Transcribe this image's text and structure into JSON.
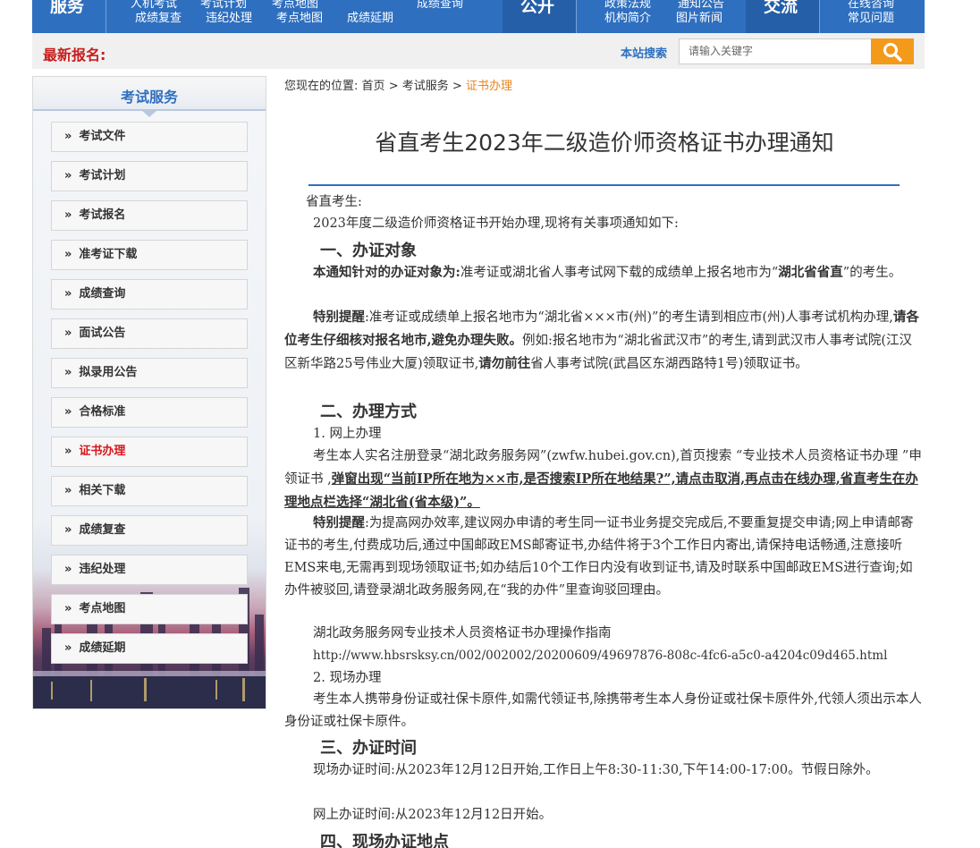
{
  "topnav": {
    "sec1_title": "服务",
    "sec1_cut": [
      "人机考试",
      "考试计划",
      "考点地图",
      "成绩查询"
    ],
    "sec1_links": [
      "成绩复查",
      "违纪处理",
      "考点地图",
      "成绩延期"
    ],
    "sec2_title": "公开",
    "sec2_cut": [
      "政策法规",
      "通知公告"
    ],
    "sec2_links": [
      "机构简介",
      "图片新闻"
    ],
    "sec3_title": "交流",
    "sec3_cut": "在线咨询",
    "sec3_link": "常见问题"
  },
  "bar2": {
    "latest_label": "最新报名:",
    "search_label": "本站搜索",
    "search_placeholder": "请输入关键字"
  },
  "sidebar": {
    "title": "考试服务",
    "items": [
      "考试文件",
      "考试计划",
      "考试报名",
      "准考证下载",
      "成绩查询",
      "面试公告",
      "拟录用公告",
      "合格标准",
      "证书办理",
      "相关下载",
      "成绩复查",
      "违纪处理",
      "考点地图",
      "成绩延期"
    ],
    "active_index": 8
  },
  "breadcrumb": {
    "prefix": "您现在的位置:",
    "home": "首页",
    "sep": ">",
    "level2": "考试服务",
    "current": "证书办理"
  },
  "article": {
    "title": "省直考生2023年二级造价师资格证书办理通知",
    "greeting": "省直考生:",
    "intro": "2023年度二级造价师资格证书开始办理,现将有关事项通知如下:",
    "h1": "一、办证对象",
    "p1_bold": "本通知针对的办证对象为:",
    "p1_text": "准考证或湖北省人事考试网下载的成绩单上报名地市为“",
    "p1_bold2": "湖北省省直",
    "p1_text2": "”的考生。",
    "p2_bold": "特别提醒",
    "p2_text": ":准考证或成绩单上报名地市为“湖北省×××市(州)”的考生请到相应市(州)人事考试机构办理,",
    "p2_bold2": "请各位考生仔细核对报名地市,避免办理失败。",
    "p2_text2": "例如:报名地市为“湖北省武汉市”的考生,请到武汉市人事考试院(江汉区新华路25号伟业大厦)领取证书,",
    "p2_bold3": "请勿前往",
    "p2_text3": "省人事考试院(武昌区东湖西路特1号)领取证书。",
    "h2": "二、办理方式",
    "s1": "1. 网上办理",
    "p3_text": "考生本人实名注册登录“湖北政务服务网”(zwfw.hubei.gov.cn),首页搜索 “专业技术人员资格证书办理 ”申领证书 ,",
    "p3_under": "弹窗出现“当前IP所在地为××市,是否搜索IP所在地结果?”,请点击取消,再点击在线办理,省直考生在办理地点栏选择“湖北省(省本级)”。",
    "p4_bold": "特别提醒",
    "p4_text": ":为提高网办效率,建议网办申请的考生同一证书业务提交完成后,不要重复提交申请;网上申请邮寄证书的考生,付费成功后,通过中国邮政EMS邮寄证书,办结件将于3个工作日内寄出,请保持电话畅通,注意接听EMS来电,无需再到现场领取证书;如办结后10个工作日内没有收到证书,请及时联系中国邮政EMS进行查询;如办件被驳回,请登录湖北政务服务网,在“我的办件”里查询驳回理由。",
    "guide": "湖北政务服务网专业技术人员资格证书办理操作指南",
    "guide_url": "http://www.hbsrsksy.cn/002/002002/20200609/49697876-808c-4fc6-a5c0-a4204c09d465.html",
    "s2": "2. 现场办理",
    "p5": "考生本人携带身份证或社保卡原件,如需代领证书,除携带考生本人身份证或社保卡原件外,代领人须出示本人身份证或社保卡原件。",
    "h3": "三、办证时间",
    "p6": "现场办证时间:从2023年12月12日开始,工作日上午8:30-11:30,下午14:00-17:00。节假日除外。",
    "p7": "网上办证时间:从2023年12月12日开始。",
    "h4": "四、现场办证地点"
  },
  "colors": {
    "brand_blue": "#2f6fbf",
    "accent_orange": "#f39a1b",
    "active_red": "#d7161c"
  }
}
